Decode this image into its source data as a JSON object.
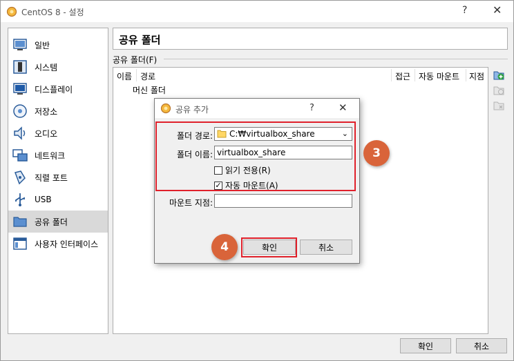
{
  "window": {
    "title": "CentOS 8 - 설정",
    "help": "?",
    "close": "✕"
  },
  "sidebar": {
    "items": [
      {
        "label": "일반",
        "icon": "general-icon"
      },
      {
        "label": "시스템",
        "icon": "system-icon"
      },
      {
        "label": "디스플레이",
        "icon": "display-icon"
      },
      {
        "label": "저장소",
        "icon": "storage-icon"
      },
      {
        "label": "오디오",
        "icon": "audio-icon"
      },
      {
        "label": "네트워크",
        "icon": "network-icon"
      },
      {
        "label": "직렬 포트",
        "icon": "serial-port-icon"
      },
      {
        "label": "USB",
        "icon": "usb-icon"
      },
      {
        "label": "공유 폴더",
        "icon": "shared-folder-icon",
        "selected": true
      },
      {
        "label": "사용자 인터페이스",
        "icon": "user-interface-icon"
      }
    ]
  },
  "main": {
    "header": "공유 폴더",
    "group_label": "공유 폴더(F)",
    "columns": {
      "name": "이름",
      "path": "경로",
      "access": "접근",
      "automount": "자동 마운트",
      "at": "지점"
    },
    "tree_row": "머신 폴더"
  },
  "footer": {
    "ok": "확인",
    "cancel": "취소"
  },
  "dialog": {
    "title": "공유 추가",
    "help": "?",
    "close": "✕",
    "folder_path_label": "폴더 경로:",
    "folder_path_value": "C:₩virtualbox_share",
    "folder_name_label": "폴더 이름:",
    "folder_name_value": "virtualbox_share",
    "readonly_label": "읽기 전용(R)",
    "readonly_checked": false,
    "automount_label": "자동 마운트(A)",
    "automount_checked": true,
    "mountpoint_label": "마운트 지점:",
    "mountpoint_value": "",
    "ok": "확인",
    "cancel": "취소"
  },
  "annotations": {
    "step3": "3",
    "step4": "4"
  },
  "colors": {
    "highlight": "#e0202a",
    "badge": "#d9643a",
    "selected": "#d9d9d9"
  }
}
